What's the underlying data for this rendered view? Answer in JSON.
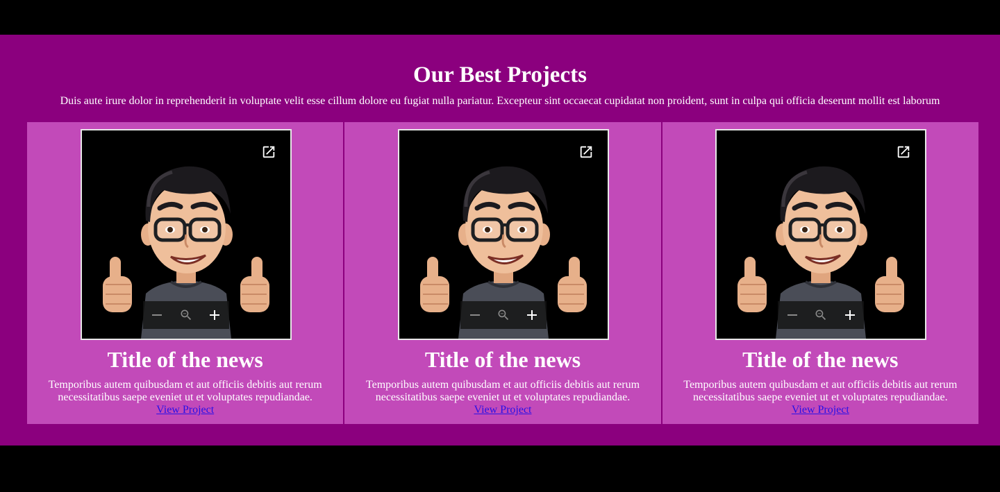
{
  "section": {
    "title": "Our Best Projects",
    "intro": "Duis aute irure dolor in reprehenderit in voluptate velit esse cillum dolore eu fugiat nulla pariatur. Excepteur sint occaecat cupidatat non proident, sunt in culpa qui officia deserunt mollit est laborum"
  },
  "colors": {
    "page_bg": "#000000",
    "section_bg": "#8b007e",
    "card_bg": "#c24ab9",
    "link": "#2a10e6"
  },
  "icons": {
    "open": "open-in-new-icon",
    "zoom_out": "minus-icon",
    "zoom_reset": "zoom-out-magnifier-icon",
    "zoom_in": "plus-icon"
  },
  "cards": [
    {
      "title": "Title of the news",
      "text": "Temporibus autem quibusdam et aut officiis debitis aut rerum necessitatibus saepe eveniet ut et voluptates repudiandae.",
      "link": "View Project"
    },
    {
      "title": "Title of the news",
      "text": "Temporibus autem quibusdam et aut officiis debitis aut rerum necessitatibus saepe eveniet ut et voluptates repudiandae.",
      "link": "View Project"
    },
    {
      "title": "Title of the news",
      "text": "Temporibus autem quibusdam et aut officiis debitis aut rerum necessitatibus saepe eveniet ut et voluptates repudiandae.",
      "link": "View Project"
    }
  ]
}
